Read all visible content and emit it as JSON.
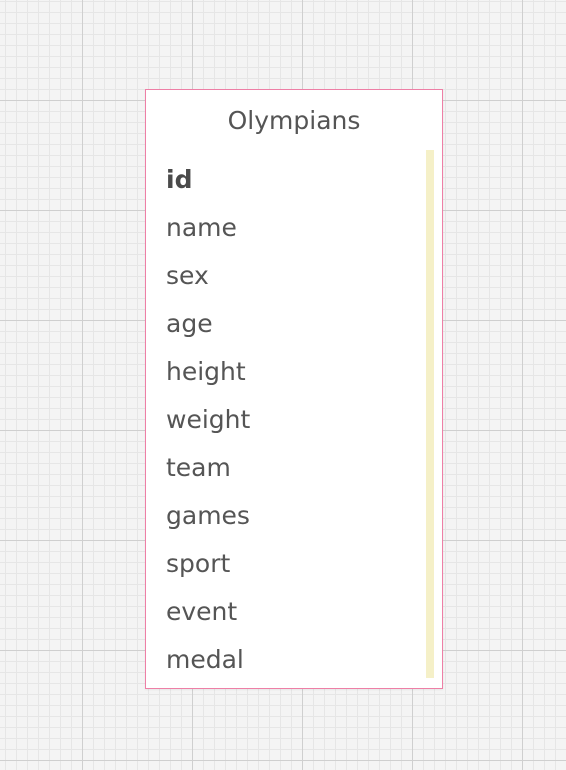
{
  "canvas": {
    "grid": "on"
  },
  "entity": {
    "title": "Olympians",
    "border_color": "#ee7fa6",
    "primary_key": "id",
    "fields": [
      "id",
      "name",
      "sex",
      "age",
      "height",
      "weight",
      "team",
      "games",
      "sport",
      "event",
      "medal"
    ]
  }
}
